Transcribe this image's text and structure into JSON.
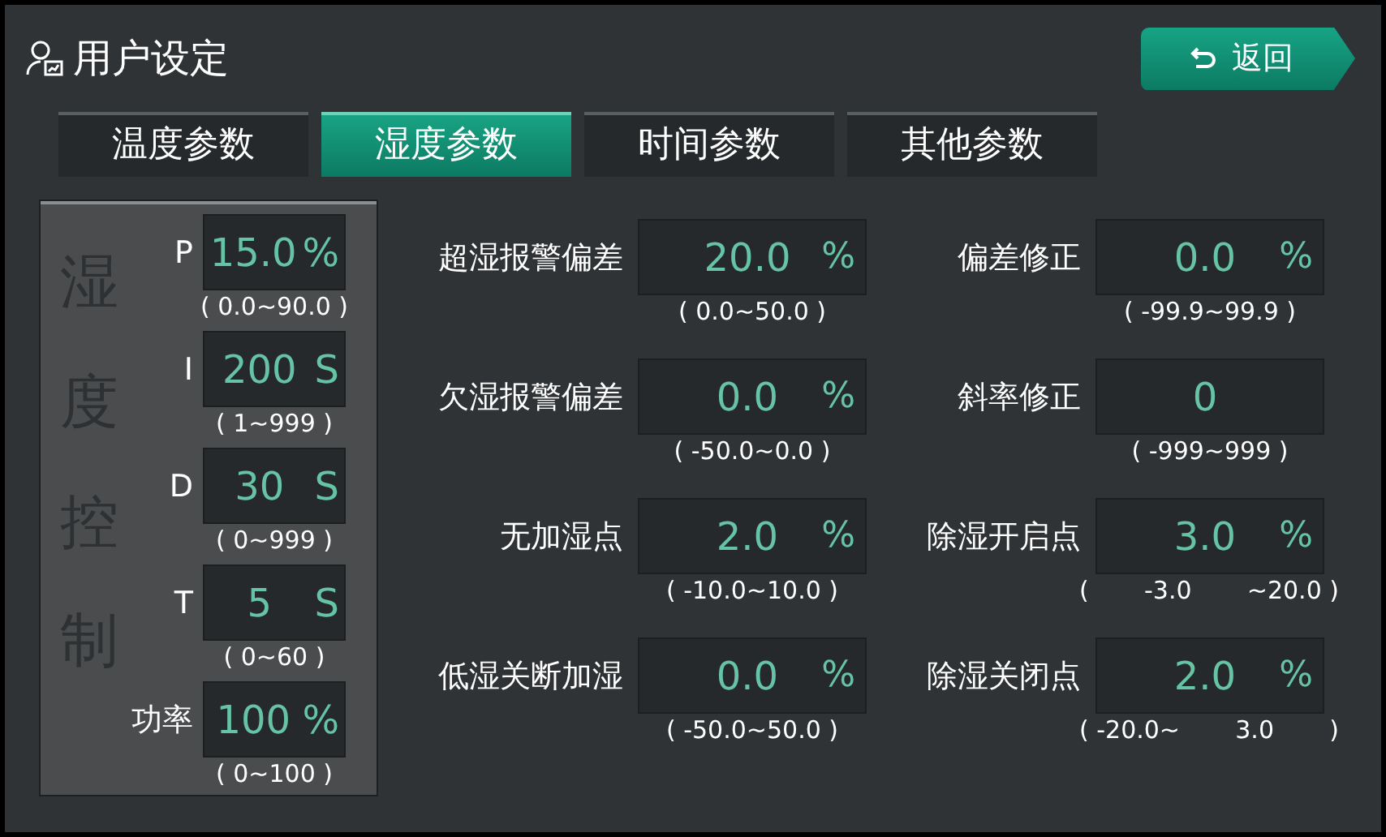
{
  "header": {
    "title": "用户设定",
    "back_button": {
      "label": "返回"
    }
  },
  "tabs": [
    {
      "label": "温度参数",
      "selected": false
    },
    {
      "label": "湿度参数",
      "selected": true
    },
    {
      "label": "时间参数",
      "selected": false
    },
    {
      "label": "其他参数",
      "selected": false
    }
  ],
  "pid_panel": {
    "title": "湿度控制",
    "rows": [
      {
        "label": "P",
        "value": "15.0",
        "unit": "%",
        "range": [
          "( 0.0~90.0 )"
        ]
      },
      {
        "label": "I",
        "value": "200",
        "unit": "S",
        "range": [
          "( 1~999 )"
        ]
      },
      {
        "label": "D",
        "value": "30",
        "unit": "S",
        "range": [
          "( 0~999 )"
        ]
      },
      {
        "label": "T",
        "value": "5",
        "unit": "S",
        "range": [
          "( 0~60 )"
        ]
      },
      {
        "label": "功率",
        "value": "100",
        "unit": "%",
        "range": [
          "( 0~100 )"
        ]
      }
    ]
  },
  "settings": [
    {
      "label": "超湿报警偏差",
      "value": "20.0",
      "unit": "%",
      "range": [
        "( 0.0~50.0 )"
      ]
    },
    {
      "label": "偏差修正",
      "value": "0.0",
      "unit": "%",
      "range": [
        "( -99.9~99.9 )"
      ]
    },
    {
      "label": "欠湿报警偏差",
      "value": "0.0",
      "unit": "%",
      "range": [
        "( -50.0~0.0 )"
      ]
    },
    {
      "label": "斜率修正",
      "value": "0",
      "range": [
        "( -999~999 )"
      ]
    },
    {
      "label": "无加湿点",
      "value": "2.0",
      "unit": "%",
      "range": [
        "( -10.0~10.0 )"
      ]
    },
    {
      "label": "除湿开启点",
      "value": "3.0",
      "unit": "%",
      "range": [
        "(",
        "-3.0",
        "~20.0 )"
      ]
    },
    {
      "label": "低湿关断加湿",
      "value": "0.0",
      "unit": "%",
      "range": [
        "( -50.0~50.0 )"
      ]
    },
    {
      "label": "除湿关闭点",
      "value": "2.0",
      "unit": "%",
      "range": [
        "( -20.0~",
        "3.0",
        ")"
      ]
    }
  ]
}
